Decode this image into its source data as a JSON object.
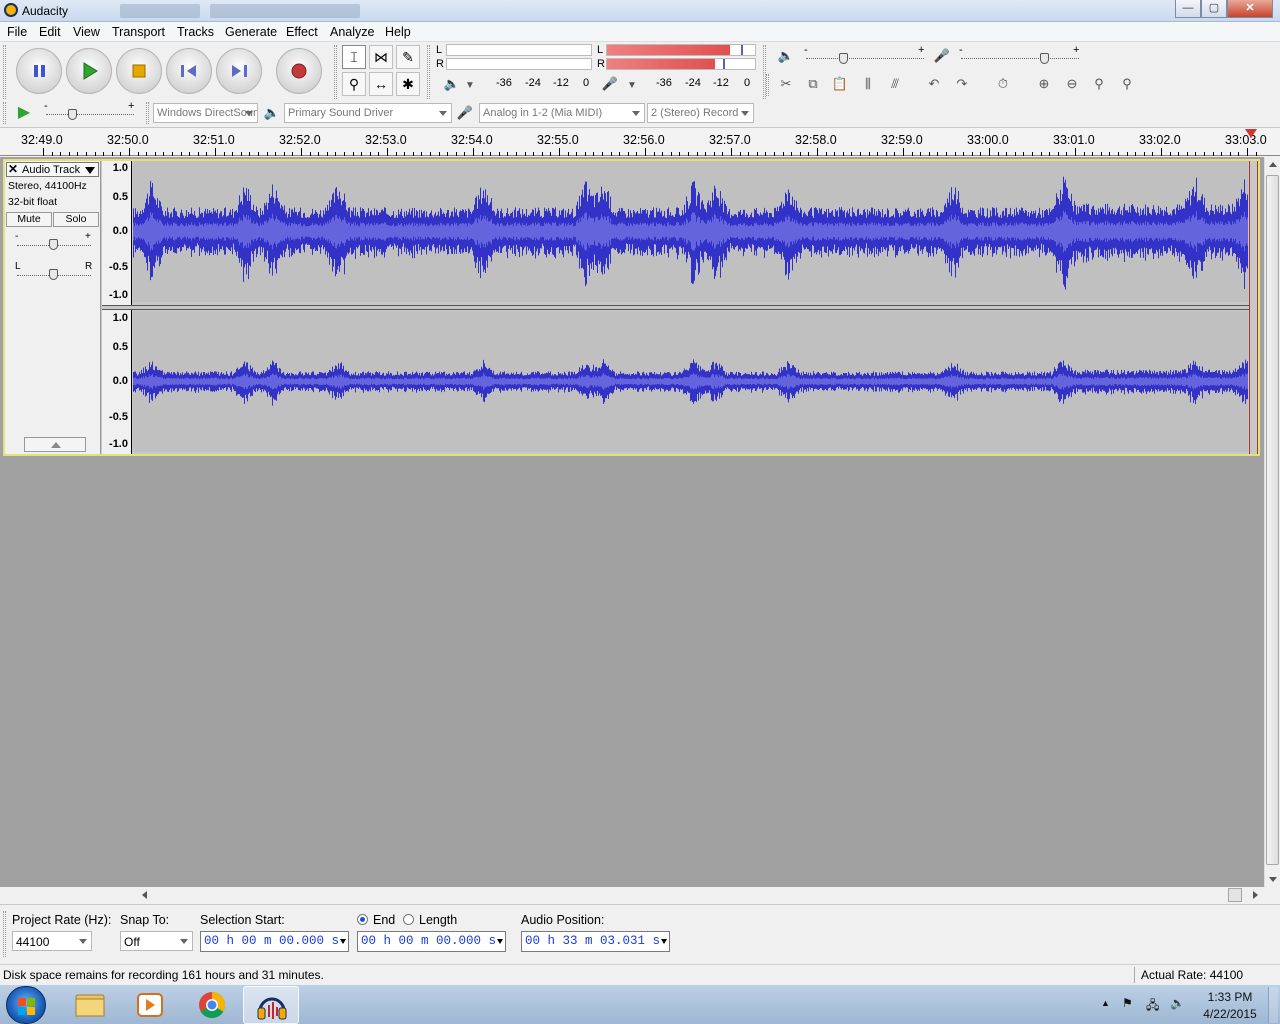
{
  "window": {
    "title": "Audacity",
    "controls": {
      "minimize": "—",
      "maximize": "▢",
      "close": "✕"
    }
  },
  "menu": [
    "File",
    "Edit",
    "View",
    "Transport",
    "Tracks",
    "Generate",
    "Effect",
    "Analyze",
    "Help"
  ],
  "transport": {
    "buttons": [
      {
        "name": "pause",
        "icon": "pause-icon"
      },
      {
        "name": "play",
        "icon": "play-icon"
      },
      {
        "name": "stop",
        "icon": "stop-icon"
      },
      {
        "name": "skip-start",
        "icon": "skip-start-icon"
      },
      {
        "name": "skip-end",
        "icon": "skip-end-icon"
      },
      {
        "name": "record",
        "icon": "record-icon"
      }
    ]
  },
  "meters": {
    "playback": {
      "channel_l": "L",
      "channel_r": "R",
      "scale": [
        "-36",
        "-24",
        "-12",
        "0"
      ],
      "level_l": 0,
      "level_r": 0
    },
    "recording": {
      "channel_l": "L",
      "channel_r": "R",
      "scale": [
        "-36",
        "-24",
        "-12",
        "0"
      ],
      "level_l": 0.83,
      "level_r": 0.73
    }
  },
  "mixer": {
    "output_min": "-",
    "output_max": "+",
    "input_min": "-",
    "input_max": "+"
  },
  "device": {
    "host": "Windows DirectSound",
    "playback_device": "Primary Sound Driver",
    "recording_device": "Analog in 1-2 (Mia MIDI)",
    "channels": "2 (Stereo) Record"
  },
  "play_at_speed": {
    "min": "-",
    "max": "+"
  },
  "timeline": {
    "labels": [
      "32:49.0",
      "32:50.0",
      "32:51.0",
      "32:52.0",
      "32:53.0",
      "32:54.0",
      "32:55.0",
      "32:56.0",
      "32:57.0",
      "32:58.0",
      "32:59.0",
      "33:00.0",
      "33:01.0",
      "33:02.0",
      "33:03.0"
    ]
  },
  "track": {
    "close_symbol": "✕",
    "name": "Audio Track",
    "format_line": "Stereo, 44100Hz",
    "bit_depth": "32-bit float",
    "mute_label": "Mute",
    "solo_label": "Solo",
    "gain_min": "-",
    "gain_max": "+",
    "pan_left": "L",
    "pan_right": "R",
    "amplitude_labels": [
      "1.0",
      "0.5",
      "0.0",
      "-0.5",
      "-1.0"
    ],
    "colors": {
      "waveform": "#3232c8",
      "waveform_rms": "#6464dc",
      "background": "#c0c0c0",
      "selected_border": "#e2e27a"
    }
  },
  "selection_toolbar": {
    "project_rate_label": "Project Rate (Hz):",
    "project_rate_value": "44100",
    "snap_to_label": "Snap To:",
    "snap_to_value": "Off",
    "selection_start_label": "Selection Start:",
    "end_label": "End",
    "length_label": "Length",
    "audio_position_label": "Audio Position:",
    "selection_start_time": "00 h 00 m 00.000 s",
    "selection_end_time": "00 h 00 m 00.000 s",
    "audio_position_time": "00 h 33 m 03.031 s"
  },
  "status": {
    "message": "Disk space remains for recording 161 hours and 31 minutes.",
    "actual_rate": "Actual Rate: 44100"
  },
  "taskbar": {
    "apps": [
      "file-explorer-icon",
      "media-player-icon",
      "chrome-icon",
      "audacity-icon"
    ],
    "clock_time": "1:33 PM",
    "clock_date": "4/22/2015"
  }
}
